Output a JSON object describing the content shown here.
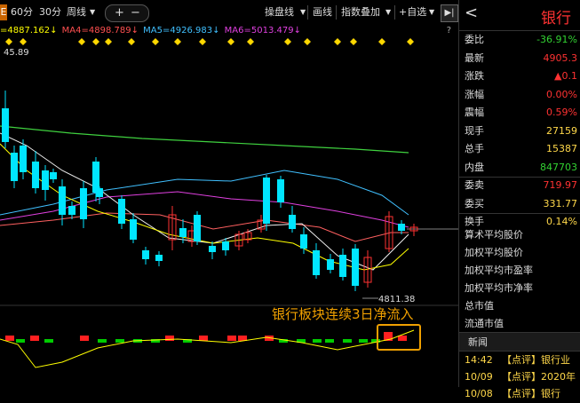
{
  "toolbar": {
    "period_left": "E",
    "period_60": "60分",
    "period_30": "30分",
    "period_week": "周线",
    "plus": "+",
    "minus": "−",
    "tool_pan": "操盘线",
    "tool_draw": "画线",
    "tool_overlay": "指数叠加",
    "tool_addfav": "+自选",
    "collapse": "▶|",
    "help": "?"
  },
  "ma": {
    "ma_partial": "=4887.162↓",
    "ma4": "MA4=4898.789↓",
    "ma5": "MA5=4926.983↓",
    "ma6": "MA6=5013.479↓"
  },
  "chart_labels": {
    "high_label": "45.89",
    "low_label": "4811.38",
    "annotation": "银行板块连续3日净流入"
  },
  "panel": {
    "back": "<",
    "title": "银行",
    "rows": [
      {
        "label": "委比",
        "value": "-36.91%"
      },
      {
        "label": "最新",
        "value": "4905.3"
      },
      {
        "label": "涨跌",
        "value": "▲0.1"
      },
      {
        "label": "涨幅",
        "value": "0.00%"
      },
      {
        "label": "震幅",
        "value": "0.59%"
      },
      {
        "label": "现手",
        "value": "27159"
      },
      {
        "label": "总手",
        "value": "15387"
      },
      {
        "label": "内盘",
        "value": "847703"
      },
      {
        "label": "委卖",
        "value": "719.97"
      },
      {
        "label": "委买",
        "value": "331.77"
      },
      {
        "label": "换手",
        "value": "0.14%"
      }
    ],
    "plain_rows": [
      "算术平均股价",
      "加权平均股价",
      "加权平均市盈率",
      "加权平均市净率",
      "总市值",
      "流通市值"
    ],
    "news_title": "新闻",
    "news": [
      {
        "time": "14:42",
        "text": "【点评】银行业"
      },
      {
        "time": "10/09",
        "text": "【点评】2020年"
      },
      {
        "time": "10/08",
        "text": "【点评】银行"
      }
    ]
  },
  "colors": {
    "up": "#ff3232",
    "down": "#00e5ff",
    "ma_yellow": "#ffff00",
    "ma_pink": "#e040e0",
    "ma_cyan": "#40c0ff",
    "ma_green": "#3fd13f",
    "vol_up": "#ff2020",
    "vol_down": "#00cc00",
    "highlight": "#f0a000",
    "flag": "#ffd700"
  }
}
